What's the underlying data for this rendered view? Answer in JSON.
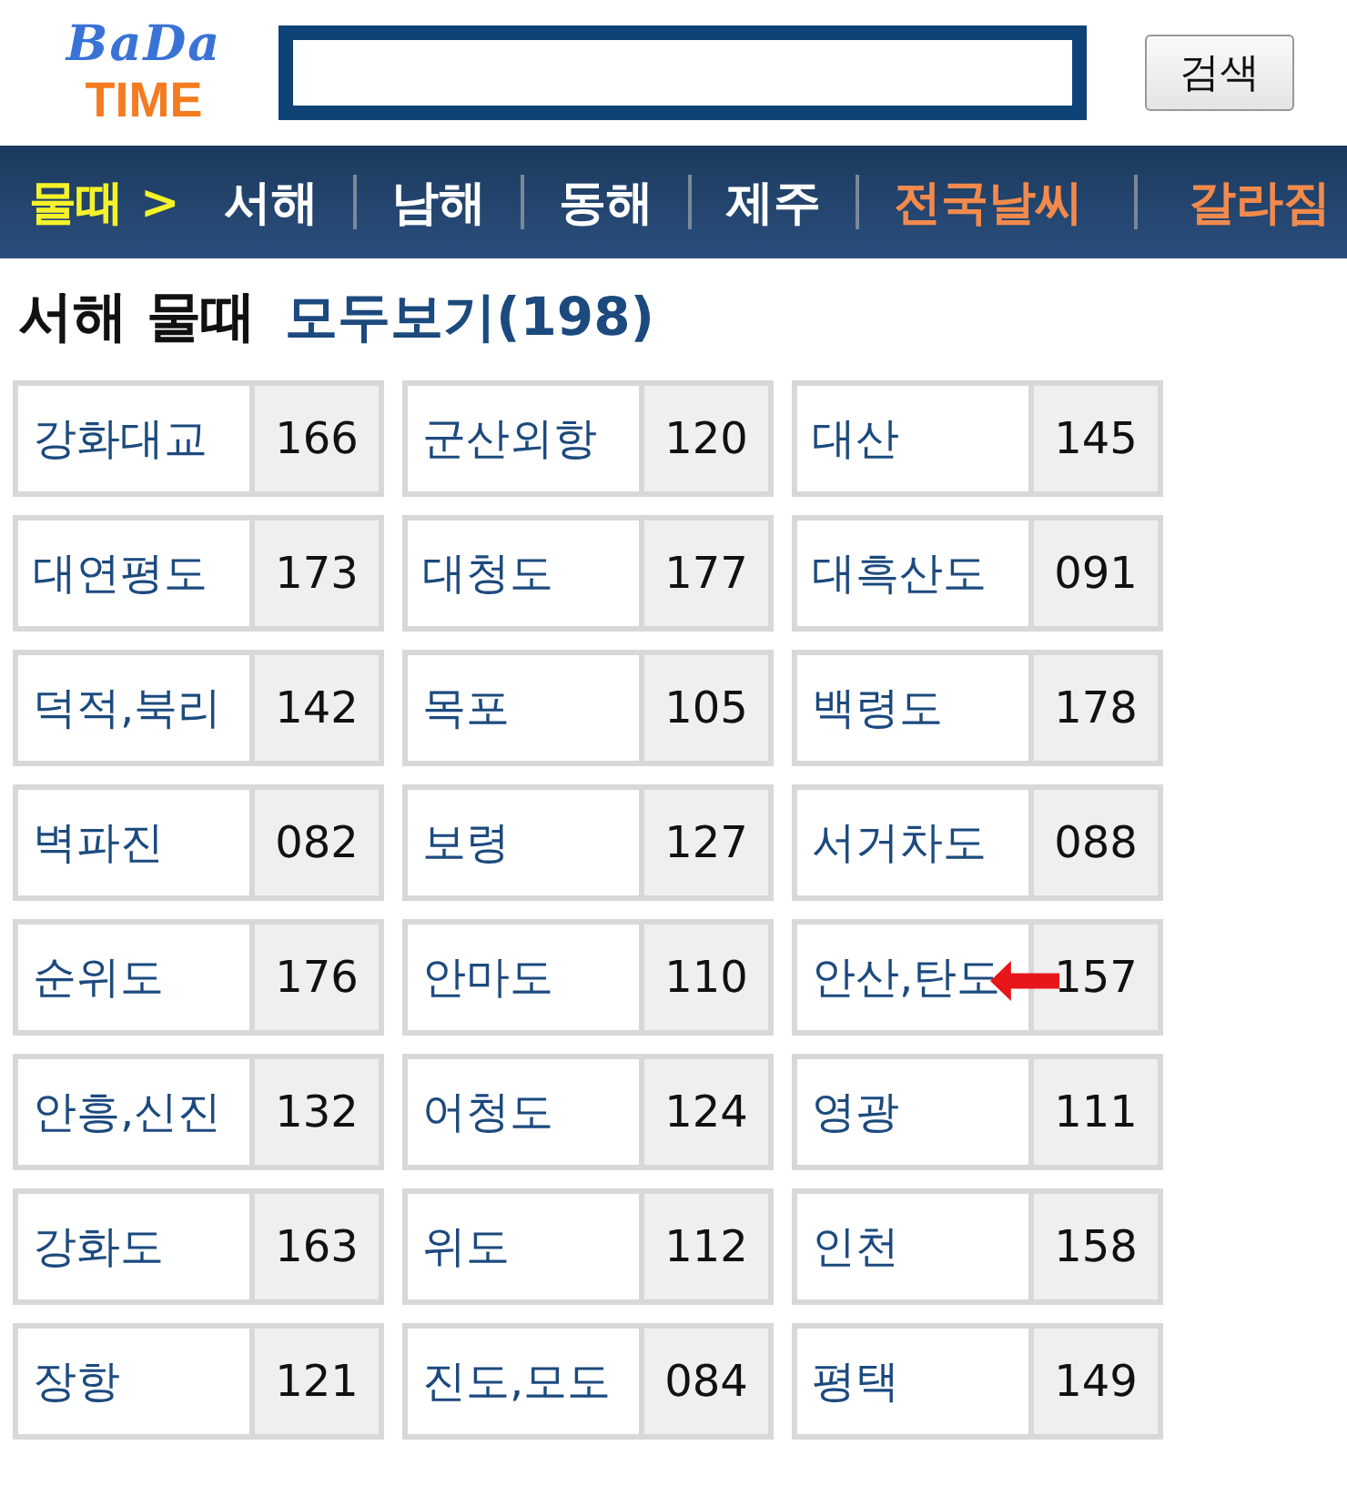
{
  "logo": {
    "top": "BaDa",
    "bottom": "TIME"
  },
  "search": {
    "button": "검색"
  },
  "nav": [
    {
      "label": "물때 >",
      "kind": "current"
    },
    {
      "label": "서해",
      "kind": "region"
    },
    {
      "label": "남해",
      "kind": "region"
    },
    {
      "label": "동해",
      "kind": "region"
    },
    {
      "label": "제주",
      "kind": "region"
    },
    {
      "label": "전국날씨",
      "kind": "extra"
    },
    {
      "label": "갈라짐",
      "kind": "extra"
    }
  ],
  "heading": {
    "title": "서해 물때",
    "link": "모두보기(198)"
  },
  "stations": [
    {
      "name": "강화대교",
      "code": "166"
    },
    {
      "name": "군산외항",
      "code": "120"
    },
    {
      "name": "대산",
      "code": "145"
    },
    {
      "name": "대연평도",
      "code": "173"
    },
    {
      "name": "대청도",
      "code": "177"
    },
    {
      "name": "대흑산도",
      "code": "091"
    },
    {
      "name": "덕적,북리",
      "code": "142"
    },
    {
      "name": "목포",
      "code": "105"
    },
    {
      "name": "백령도",
      "code": "178"
    },
    {
      "name": "벽파진",
      "code": "082"
    },
    {
      "name": "보령",
      "code": "127"
    },
    {
      "name": "서거차도",
      "code": "088"
    },
    {
      "name": "순위도",
      "code": "176"
    },
    {
      "name": "안마도",
      "code": "110"
    },
    {
      "name": "안산,탄도",
      "code": "157",
      "arrow": true
    },
    {
      "name": "안흥,신진",
      "code": "132"
    },
    {
      "name": "어청도",
      "code": "124"
    },
    {
      "name": "영광",
      "code": "111"
    },
    {
      "name": "강화도",
      "code": "163"
    },
    {
      "name": "위도",
      "code": "112"
    },
    {
      "name": "인천",
      "code": "158"
    },
    {
      "name": "장항",
      "code": "121"
    },
    {
      "name": "진도,모도",
      "code": "084"
    },
    {
      "name": "평택",
      "code": "149"
    }
  ]
}
